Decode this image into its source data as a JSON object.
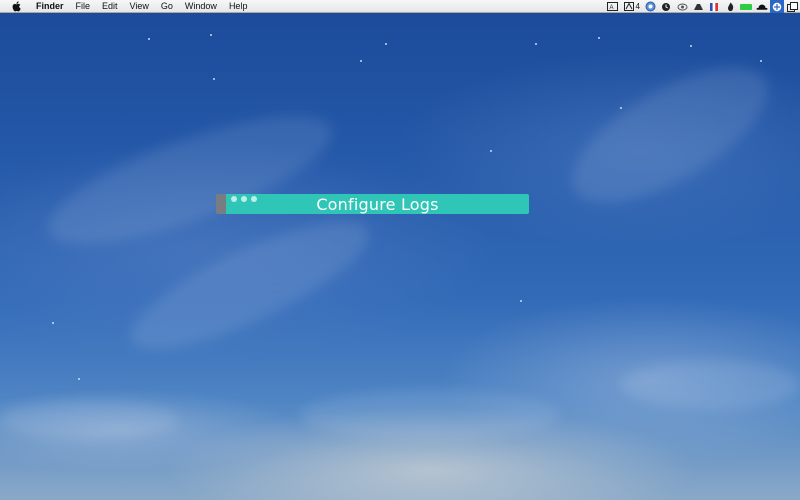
{
  "menubar": {
    "app_name": "Finder",
    "items": [
      "File",
      "Edit",
      "View",
      "Go",
      "Window",
      "Help"
    ],
    "status": {
      "adobe_count": "4"
    }
  },
  "window": {
    "title": "Configure Logs"
  },
  "colors": {
    "accent_teal": "#2fc6b7",
    "handle_gray": "#777d80",
    "menubar_active": "#2c67c8"
  }
}
